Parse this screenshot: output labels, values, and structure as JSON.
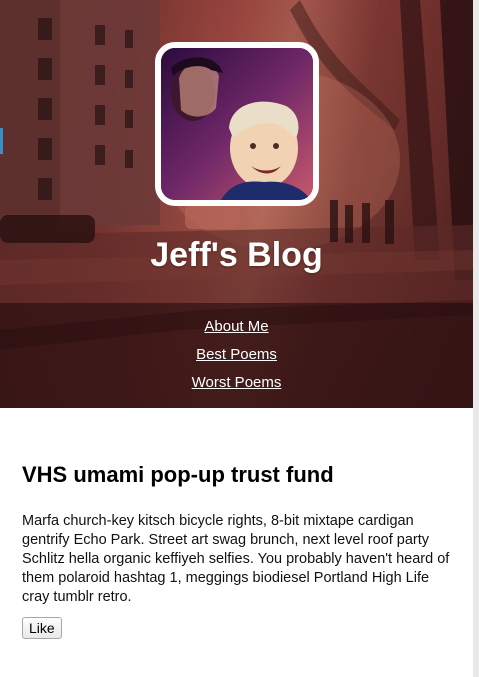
{
  "header": {
    "blog_title": "Jeff's Blog",
    "avatar_icon": "profile-photo"
  },
  "nav": {
    "items": [
      {
        "label": "About Me"
      },
      {
        "label": "Best Poems"
      },
      {
        "label": "Worst Poems"
      }
    ]
  },
  "post": {
    "title": "VHS umami pop-up trust fund",
    "body": "Marfa church-key kitsch bicycle rights, 8-bit mixtape cardigan gentrify Echo Park. Street art swag brunch, next level roof party Schlitz hella organic keffiyeh selfies. You probably haven't heard of them polaroid hashtag 1, meggings biodiesel Portland High Life cray tumblr retro.",
    "like_label": "Like"
  },
  "colors": {
    "hero_tint": "#7a3a34",
    "nav_band": "#1e080a",
    "title_text": "#ffffff",
    "link_text": "#ffffff"
  }
}
